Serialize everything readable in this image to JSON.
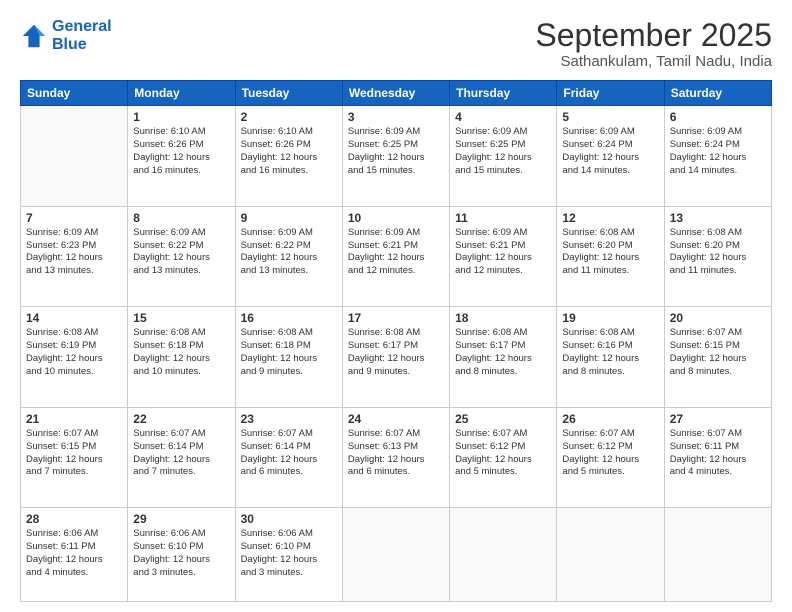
{
  "header": {
    "logo_line1": "General",
    "logo_line2": "Blue",
    "title": "September 2025",
    "subtitle": "Sathankulam, Tamil Nadu, India"
  },
  "weekdays": [
    "Sunday",
    "Monday",
    "Tuesday",
    "Wednesday",
    "Thursday",
    "Friday",
    "Saturday"
  ],
  "weeks": [
    [
      {
        "day": "",
        "info": ""
      },
      {
        "day": "1",
        "info": "Sunrise: 6:10 AM\nSunset: 6:26 PM\nDaylight: 12 hours\nand 16 minutes."
      },
      {
        "day": "2",
        "info": "Sunrise: 6:10 AM\nSunset: 6:26 PM\nDaylight: 12 hours\nand 16 minutes."
      },
      {
        "day": "3",
        "info": "Sunrise: 6:09 AM\nSunset: 6:25 PM\nDaylight: 12 hours\nand 15 minutes."
      },
      {
        "day": "4",
        "info": "Sunrise: 6:09 AM\nSunset: 6:25 PM\nDaylight: 12 hours\nand 15 minutes."
      },
      {
        "day": "5",
        "info": "Sunrise: 6:09 AM\nSunset: 6:24 PM\nDaylight: 12 hours\nand 14 minutes."
      },
      {
        "day": "6",
        "info": "Sunrise: 6:09 AM\nSunset: 6:24 PM\nDaylight: 12 hours\nand 14 minutes."
      }
    ],
    [
      {
        "day": "7",
        "info": "Sunrise: 6:09 AM\nSunset: 6:23 PM\nDaylight: 12 hours\nand 13 minutes."
      },
      {
        "day": "8",
        "info": "Sunrise: 6:09 AM\nSunset: 6:22 PM\nDaylight: 12 hours\nand 13 minutes."
      },
      {
        "day": "9",
        "info": "Sunrise: 6:09 AM\nSunset: 6:22 PM\nDaylight: 12 hours\nand 13 minutes."
      },
      {
        "day": "10",
        "info": "Sunrise: 6:09 AM\nSunset: 6:21 PM\nDaylight: 12 hours\nand 12 minutes."
      },
      {
        "day": "11",
        "info": "Sunrise: 6:09 AM\nSunset: 6:21 PM\nDaylight: 12 hours\nand 12 minutes."
      },
      {
        "day": "12",
        "info": "Sunrise: 6:08 AM\nSunset: 6:20 PM\nDaylight: 12 hours\nand 11 minutes."
      },
      {
        "day": "13",
        "info": "Sunrise: 6:08 AM\nSunset: 6:20 PM\nDaylight: 12 hours\nand 11 minutes."
      }
    ],
    [
      {
        "day": "14",
        "info": "Sunrise: 6:08 AM\nSunset: 6:19 PM\nDaylight: 12 hours\nand 10 minutes."
      },
      {
        "day": "15",
        "info": "Sunrise: 6:08 AM\nSunset: 6:18 PM\nDaylight: 12 hours\nand 10 minutes."
      },
      {
        "day": "16",
        "info": "Sunrise: 6:08 AM\nSunset: 6:18 PM\nDaylight: 12 hours\nand 9 minutes."
      },
      {
        "day": "17",
        "info": "Sunrise: 6:08 AM\nSunset: 6:17 PM\nDaylight: 12 hours\nand 9 minutes."
      },
      {
        "day": "18",
        "info": "Sunrise: 6:08 AM\nSunset: 6:17 PM\nDaylight: 12 hours\nand 8 minutes."
      },
      {
        "day": "19",
        "info": "Sunrise: 6:08 AM\nSunset: 6:16 PM\nDaylight: 12 hours\nand 8 minutes."
      },
      {
        "day": "20",
        "info": "Sunrise: 6:07 AM\nSunset: 6:15 PM\nDaylight: 12 hours\nand 8 minutes."
      }
    ],
    [
      {
        "day": "21",
        "info": "Sunrise: 6:07 AM\nSunset: 6:15 PM\nDaylight: 12 hours\nand 7 minutes."
      },
      {
        "day": "22",
        "info": "Sunrise: 6:07 AM\nSunset: 6:14 PM\nDaylight: 12 hours\nand 7 minutes."
      },
      {
        "day": "23",
        "info": "Sunrise: 6:07 AM\nSunset: 6:14 PM\nDaylight: 12 hours\nand 6 minutes."
      },
      {
        "day": "24",
        "info": "Sunrise: 6:07 AM\nSunset: 6:13 PM\nDaylight: 12 hours\nand 6 minutes."
      },
      {
        "day": "25",
        "info": "Sunrise: 6:07 AM\nSunset: 6:12 PM\nDaylight: 12 hours\nand 5 minutes."
      },
      {
        "day": "26",
        "info": "Sunrise: 6:07 AM\nSunset: 6:12 PM\nDaylight: 12 hours\nand 5 minutes."
      },
      {
        "day": "27",
        "info": "Sunrise: 6:07 AM\nSunset: 6:11 PM\nDaylight: 12 hours\nand 4 minutes."
      }
    ],
    [
      {
        "day": "28",
        "info": "Sunrise: 6:06 AM\nSunset: 6:11 PM\nDaylight: 12 hours\nand 4 minutes."
      },
      {
        "day": "29",
        "info": "Sunrise: 6:06 AM\nSunset: 6:10 PM\nDaylight: 12 hours\nand 3 minutes."
      },
      {
        "day": "30",
        "info": "Sunrise: 6:06 AM\nSunset: 6:10 PM\nDaylight: 12 hours\nand 3 minutes."
      },
      {
        "day": "",
        "info": ""
      },
      {
        "day": "",
        "info": ""
      },
      {
        "day": "",
        "info": ""
      },
      {
        "day": "",
        "info": ""
      }
    ]
  ]
}
